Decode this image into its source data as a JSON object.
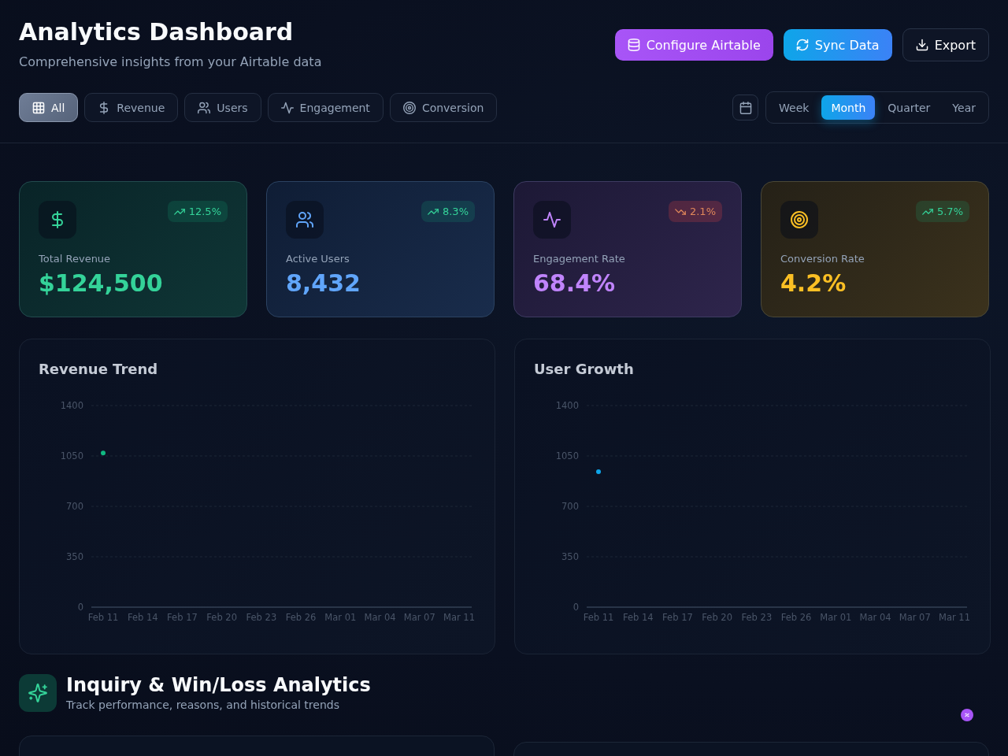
{
  "header": {
    "title": "Analytics Dashboard",
    "subtitle": "Comprehensive insights from your Airtable data",
    "buttons": [
      {
        "label": "Configure Airtable",
        "kind": "primary"
      },
      {
        "label": "Sync Data",
        "kind": "sync"
      },
      {
        "label": "Export",
        "kind": "outline"
      }
    ]
  },
  "filters": [
    {
      "label": "All",
      "selected": true
    },
    {
      "label": "Revenue",
      "selected": false
    },
    {
      "label": "Users",
      "selected": false
    },
    {
      "label": "Engagement",
      "selected": false
    },
    {
      "label": "Conversion",
      "selected": false
    }
  ],
  "periods": [
    {
      "label": "Week",
      "selected": false
    },
    {
      "label": "Month",
      "selected": true
    },
    {
      "label": "Quarter",
      "selected": false
    },
    {
      "label": "Year",
      "selected": false
    }
  ],
  "kpis": [
    {
      "label": "Total Revenue",
      "value": "$124,500",
      "change": "12.5%",
      "rising": true,
      "color": "#34d399"
    },
    {
      "label": "Active Users",
      "value": "8,432",
      "change": "8.3%",
      "rising": true,
      "color": "#60a5fa"
    },
    {
      "label": "Engagement Rate",
      "value": "68.4%",
      "change": "2.1%",
      "rising": false,
      "color": "#c084fc"
    },
    {
      "label": "Conversion Rate",
      "value": "4.2%",
      "change": "5.7%",
      "rising": true,
      "color": "#fbbf24"
    }
  ],
  "charts": [
    {
      "title": "Revenue Trend",
      "chart_data": {
        "type": "line",
        "categories": [
          "Feb 11",
          "Feb 14",
          "Feb 17",
          "Feb 20",
          "Feb 23",
          "Feb 26",
          "Mar 01",
          "Mar 04",
          "Mar 07",
          "Mar 11"
        ],
        "ylim": [
          0,
          1400
        ],
        "yticks": [
          0,
          350,
          700,
          1050,
          1400
        ],
        "grid": true,
        "series": [
          {
            "color": "#10b981",
            "marker": true,
            "values": [
              1070,
              null,
              null,
              null,
              null,
              null,
              null,
              null,
              null,
              null
            ]
          }
        ]
      }
    },
    {
      "title": "User Growth",
      "chart_data": {
        "type": "line",
        "categories": [
          "Feb 11",
          "Feb 14",
          "Feb 17",
          "Feb 20",
          "Feb 23",
          "Feb 26",
          "Mar 01",
          "Mar 04",
          "Mar 07",
          "Mar 11"
        ],
        "ylim": [
          0,
          1400
        ],
        "yticks": [
          0,
          350,
          700,
          1050,
          1400
        ],
        "grid": true,
        "series": [
          {
            "color": "#0ea5e9",
            "marker": true,
            "values": [
              940,
              null,
              null,
              null,
              null,
              null,
              null,
              null,
              null,
              null
            ]
          }
        ]
      }
    }
  ],
  "inquiry_section": {
    "title": "Inquiry & Win/Loss Analytics",
    "subtitle": "Track performance, reasons, and historical trends"
  }
}
